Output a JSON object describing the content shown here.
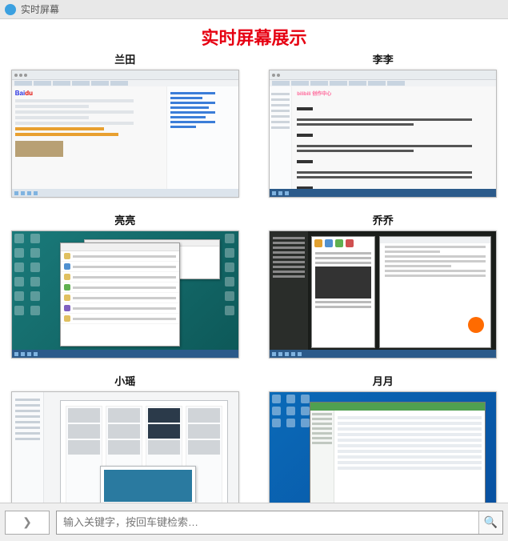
{
  "header": {
    "app_title": "实时屏幕"
  },
  "banner": {
    "title": "实时屏幕展示"
  },
  "tiles": [
    {
      "label": "兰田"
    },
    {
      "label": "李李"
    },
    {
      "label": "亮亮"
    },
    {
      "label": "乔乔"
    },
    {
      "label": "小瑶"
    },
    {
      "label": "月月"
    }
  ],
  "baidu": {
    "logo_bai": "Bai",
    "logo_du": "du"
  },
  "bili": {
    "logo": "bilibili 创作中心"
  },
  "bottom": {
    "caret": "❯",
    "placeholder": "输入关键字，按回车键检索…",
    "search_icon": "🔍"
  }
}
